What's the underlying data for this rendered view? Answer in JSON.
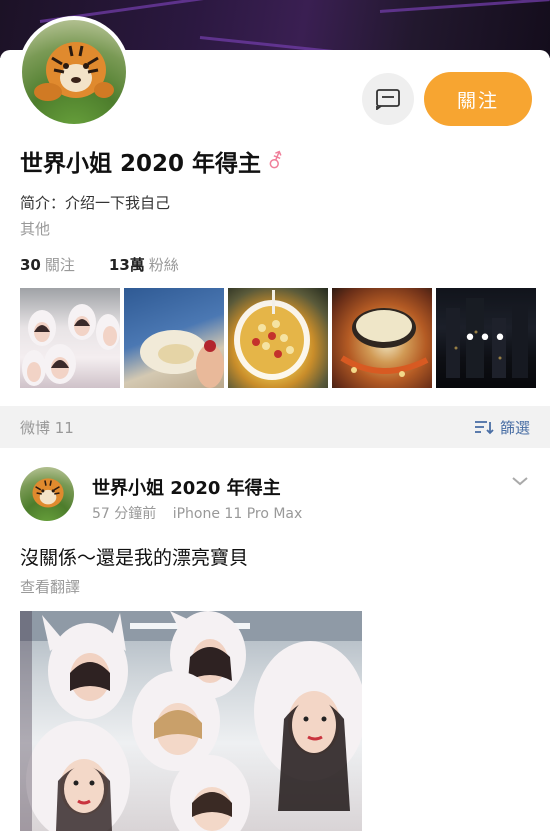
{
  "profile": {
    "name": "世界小姐 2020 年得主",
    "gender_symbol": "⚦",
    "bio": "简介：介绍一下我自己",
    "other": "其他",
    "following_count": "30",
    "following_label": "關注",
    "followers_count": "13萬",
    "followers_label": "粉絲",
    "follow_button": "關注",
    "more_photos": "•••"
  },
  "feed_bar": {
    "count_label": "微博 11",
    "filter_label": "篩選"
  },
  "post": {
    "author": "世界小姐 2020 年得主",
    "time": "57 分鐘前",
    "device": "iPhone 11 Pro Max",
    "text": "沒關係～還是我的漂亮寶貝",
    "translate": "查看翻譯"
  },
  "icons": {
    "message": "message-icon",
    "filter": "filter-icon",
    "chevron": "chevron-down-icon",
    "gender": "gender-icon"
  },
  "colors": {
    "accent": "#f7a531",
    "link": "#4a6fa5",
    "gender": "#f07f9a"
  }
}
